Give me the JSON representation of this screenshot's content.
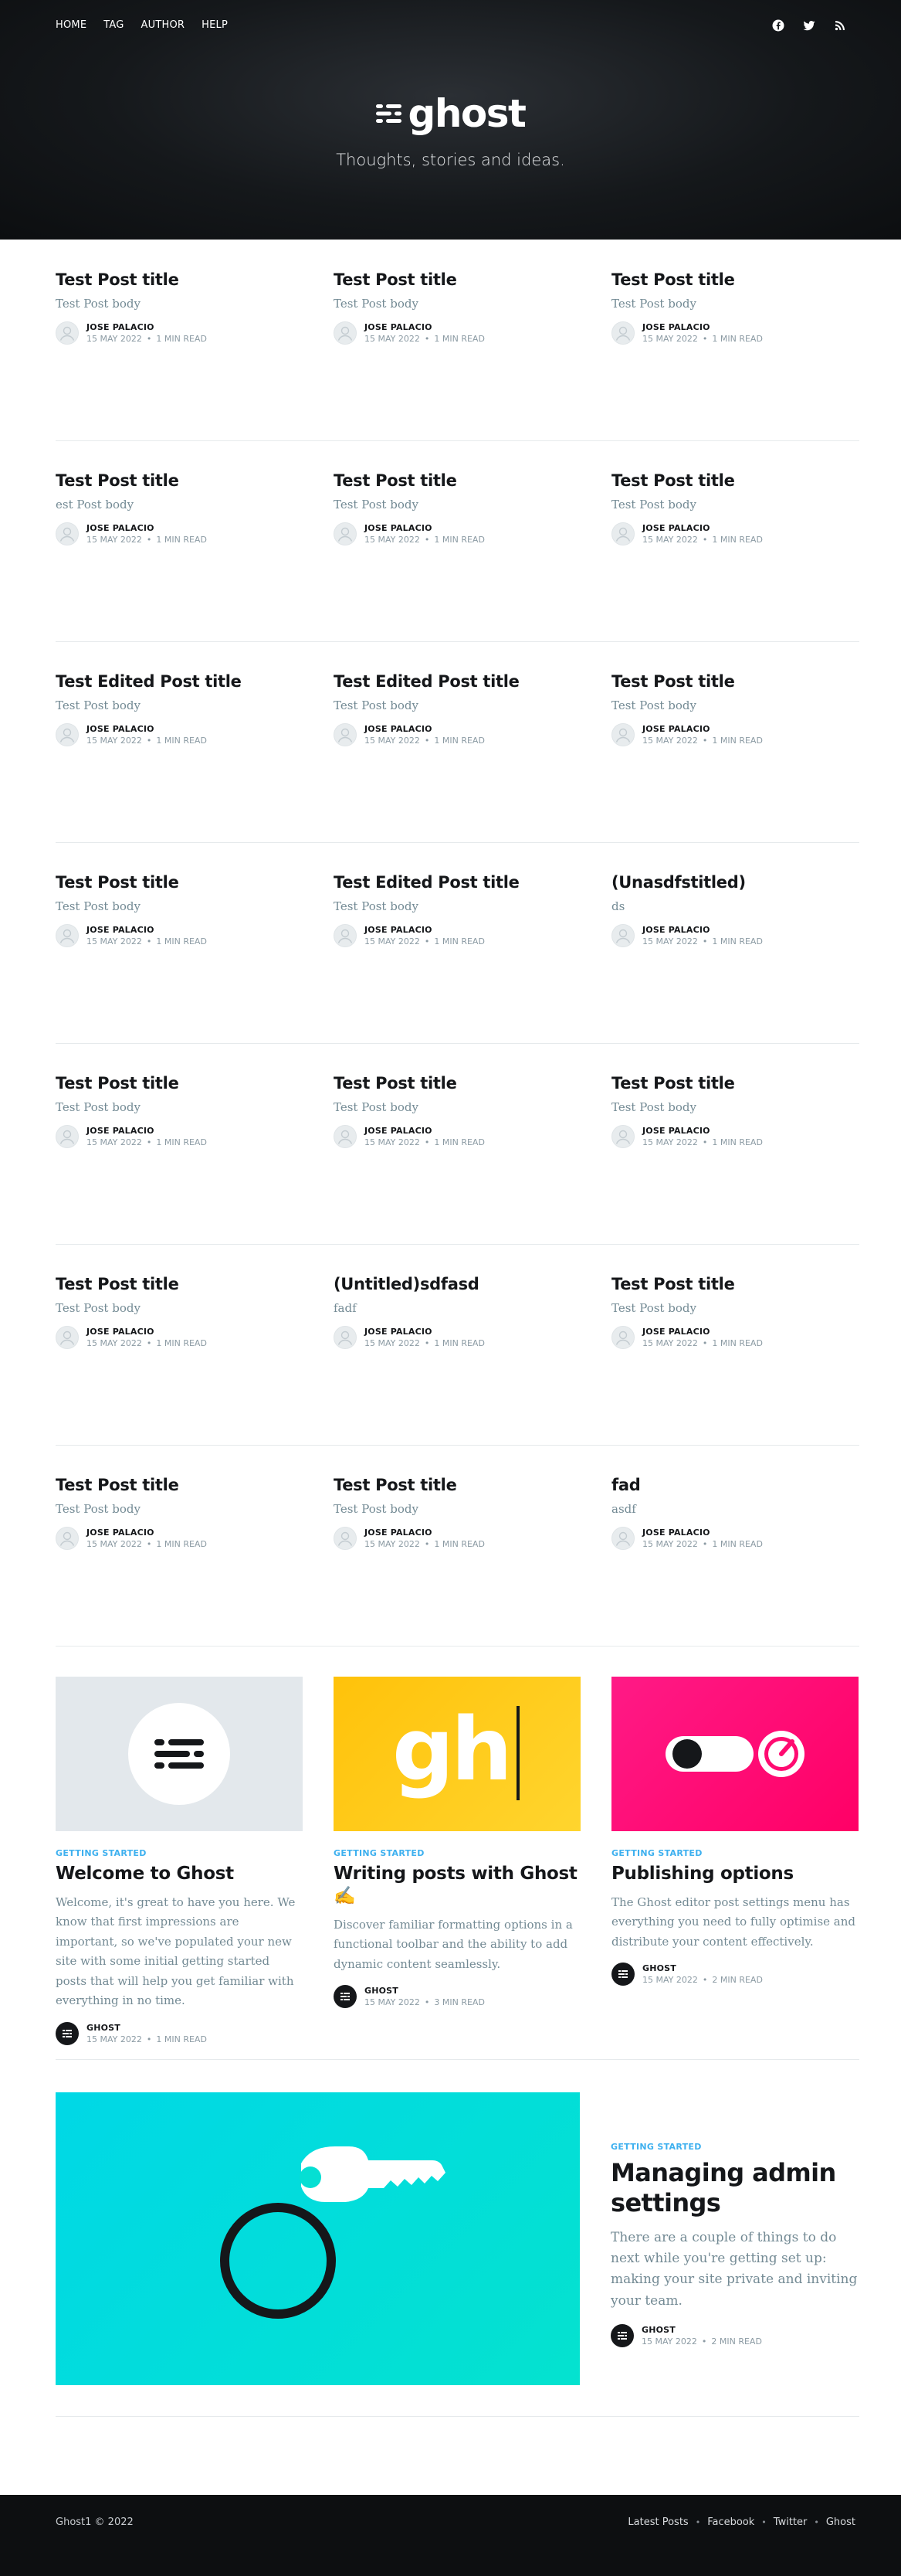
{
  "header": {
    "nav": [
      "HOME",
      "TAG",
      "AUTHOR",
      "HELP"
    ],
    "brand_name": "ghost",
    "tagline": "Thoughts, stories and ideas.",
    "social_icons": [
      "facebook-icon",
      "twitter-icon",
      "rss-icon"
    ]
  },
  "posts": [
    {
      "title": "Test Post title",
      "excerpt": "Test Post body",
      "author": "JOSE PALACIO",
      "date": "15 MAY 2022",
      "read": "1 MIN READ"
    },
    {
      "title": "Test Post title",
      "excerpt": "Test Post body",
      "author": "JOSE PALACIO",
      "date": "15 MAY 2022",
      "read": "1 MIN READ"
    },
    {
      "title": "Test Post title",
      "excerpt": "Test Post body",
      "author": "JOSE PALACIO",
      "date": "15 MAY 2022",
      "read": "1 MIN READ"
    },
    {
      "title": "Test Post title",
      "excerpt": "est Post body",
      "author": "JOSE PALACIO",
      "date": "15 MAY 2022",
      "read": "1 MIN READ"
    },
    {
      "title": "Test Post title",
      "excerpt": "Test Post body",
      "author": "JOSE PALACIO",
      "date": "15 MAY 2022",
      "read": "1 MIN READ"
    },
    {
      "title": "Test Post title",
      "excerpt": "Test Post body",
      "author": "JOSE PALACIO",
      "date": "15 MAY 2022",
      "read": "1 MIN READ"
    },
    {
      "title": "Test Edited Post title",
      "excerpt": "Test Post body",
      "author": "JOSE PALACIO",
      "date": "15 MAY 2022",
      "read": "1 MIN READ"
    },
    {
      "title": "Test Edited Post title",
      "excerpt": "Test Post body",
      "author": "JOSE PALACIO",
      "date": "15 MAY 2022",
      "read": "1 MIN READ"
    },
    {
      "title": "Test Post title",
      "excerpt": "Test Post body",
      "author": "JOSE PALACIO",
      "date": "15 MAY 2022",
      "read": "1 MIN READ"
    },
    {
      "title": "Test Post title",
      "excerpt": "Test Post body",
      "author": "JOSE PALACIO",
      "date": "15 MAY 2022",
      "read": "1 MIN READ"
    },
    {
      "title": "Test Edited Post title",
      "excerpt": "Test Post body",
      "author": "JOSE PALACIO",
      "date": "15 MAY 2022",
      "read": "1 MIN READ"
    },
    {
      "title": "(Unasdfstitled)",
      "excerpt": "ds",
      "author": "JOSE PALACIO",
      "date": "15 MAY 2022",
      "read": "1 MIN READ"
    },
    {
      "title": "Test Post title",
      "excerpt": "Test Post body",
      "author": "JOSE PALACIO",
      "date": "15 MAY 2022",
      "read": "1 MIN READ"
    },
    {
      "title": "Test Post title",
      "excerpt": "Test Post body",
      "author": "JOSE PALACIO",
      "date": "15 MAY 2022",
      "read": "1 MIN READ"
    },
    {
      "title": "Test Post title",
      "excerpt": "Test Post body",
      "author": "JOSE PALACIO",
      "date": "15 MAY 2022",
      "read": "1 MIN READ"
    },
    {
      "title": "Test Post title",
      "excerpt": "Test Post body",
      "author": "JOSE PALACIO",
      "date": "15 MAY 2022",
      "read": "1 MIN READ"
    },
    {
      "title": "(Untitled)sdfasd",
      "excerpt": "fadf",
      "author": "JOSE PALACIO",
      "date": "15 MAY 2022",
      "read": "1 MIN READ"
    },
    {
      "title": "Test Post title",
      "excerpt": "Test Post body",
      "author": "JOSE PALACIO",
      "date": "15 MAY 2022",
      "read": "1 MIN READ"
    },
    {
      "title": "Test Post title",
      "excerpt": "Test Post body",
      "author": "JOSE PALACIO",
      "date": "15 MAY 2022",
      "read": "1 MIN READ"
    },
    {
      "title": "Test Post title",
      "excerpt": "Test Post body",
      "author": "JOSE PALACIO",
      "date": "15 MAY 2022",
      "read": "1 MIN READ"
    },
    {
      "title": "fad",
      "excerpt": "asdf",
      "author": "JOSE PALACIO",
      "date": "15 MAY 2022",
      "read": "1 MIN READ"
    }
  ],
  "featured": [
    {
      "tag": "GETTING STARTED",
      "title": "Welcome to Ghost",
      "excerpt": "Welcome, it's great to have you here. We know that first impressions are important, so we've populated your new site with some initial getting started posts that will help you get familiar with everything in no time.",
      "author": "GHOST",
      "date": "15 MAY 2022",
      "read": "1 MIN READ",
      "image_bg": "#e3e8ec"
    },
    {
      "tag": "GETTING STARTED",
      "title": "Writing posts with Ghost ✍️",
      "excerpt": "Discover familiar formatting options in a functional toolbar and the ability to add dynamic content seamlessly.",
      "author": "GHOST",
      "date": "15 MAY 2022",
      "read": "3 MIN READ",
      "image_text": "gh",
      "image_bg": "#ffcc12"
    },
    {
      "tag": "GETTING STARTED",
      "title": "Publishing options",
      "excerpt": "The Ghost editor post settings menu has everything you need to fully optimise and distribute your content effectively.",
      "author": "GHOST",
      "date": "15 MAY 2022",
      "read": "2 MIN READ",
      "image_bg": "#ff0b71"
    }
  ],
  "big_feature": {
    "tag": "GETTING STARTED",
    "title": "Managing admin settings",
    "excerpt": "There are a couple of things to do next while you're getting set up: making your site private and inviting your team.",
    "author": "GHOST",
    "date": "15 MAY 2022",
    "read": "2 MIN READ",
    "image_bg": "#00e0dc"
  },
  "footer": {
    "copyright": "Ghost1 © 2022",
    "links": [
      "Latest Posts",
      "Facebook",
      "Twitter",
      "Ghost"
    ]
  },
  "colors": {
    "accent": "#3eb0ef",
    "excerpt": "#738a94",
    "header_bg": "#15181b"
  }
}
